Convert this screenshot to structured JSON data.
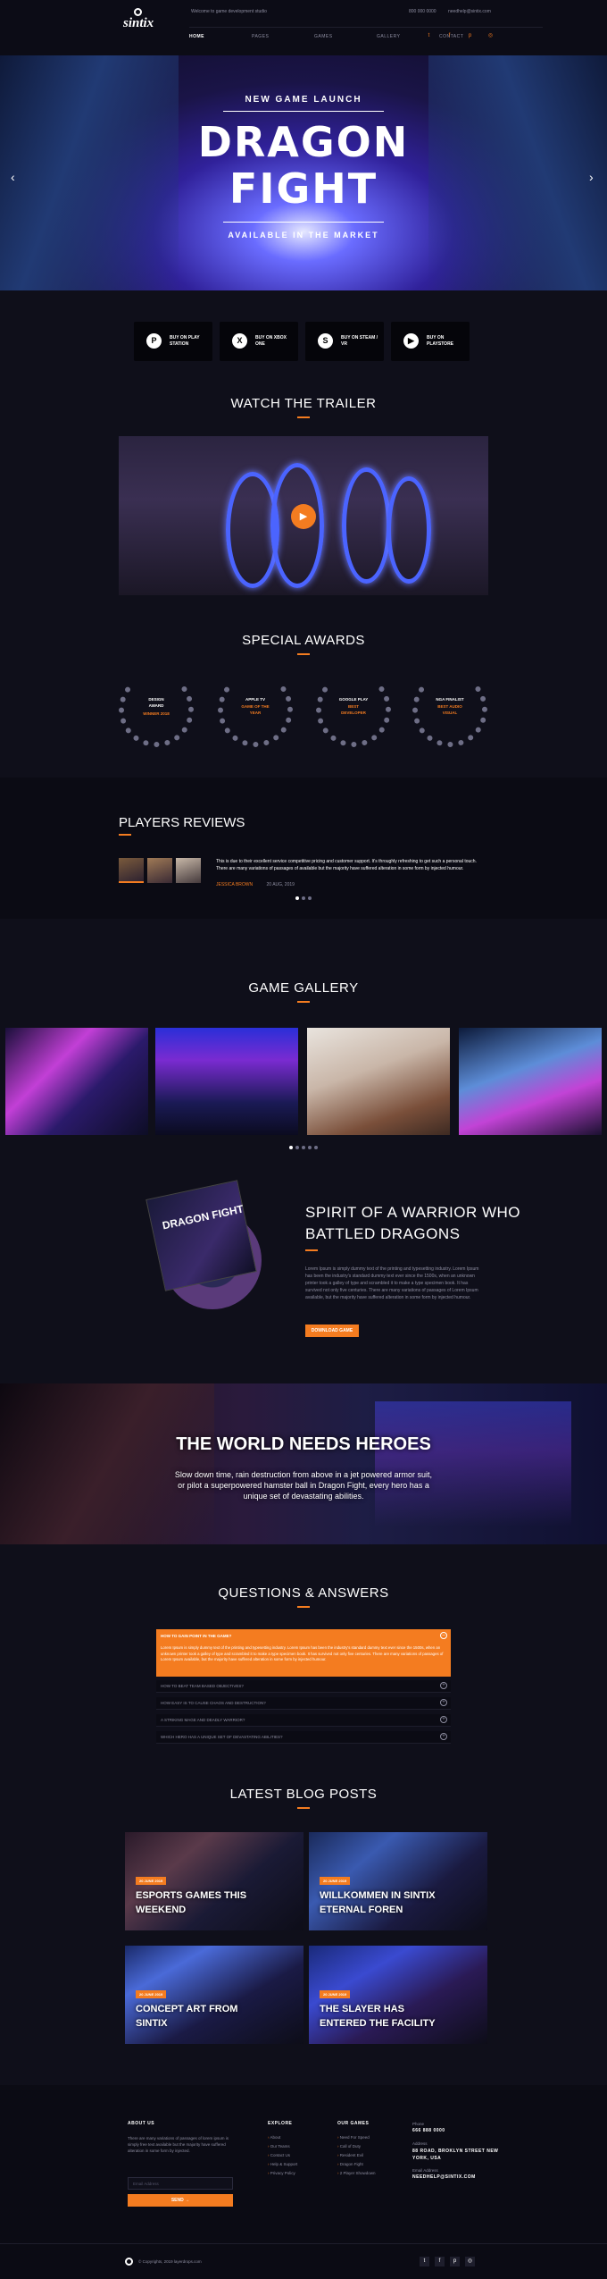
{
  "header": {
    "brand": "sintix",
    "welcome": "Welcome to game development studio",
    "phone": "800 000 0000",
    "email": "needhelp@sintix.com",
    "nav": [
      "HOME",
      "PAGES",
      "GAMES",
      "GALLERY",
      "CONTACT"
    ],
    "social": [
      "twitter",
      "facebook",
      "pinterest",
      "instagram"
    ]
  },
  "hero": {
    "kicker": "NEW GAME LAUNCH",
    "title_line1": "DRAGON",
    "title_line2": "FIGHT",
    "subtitle": "AVAILABLE IN THE MARKET",
    "prev": "‹",
    "next": "›"
  },
  "stores": [
    {
      "label": "BUY ON PLAY STATION",
      "icon": "playstation-icon",
      "glyph": "P"
    },
    {
      "label": "BUY ON XBOX ONE",
      "icon": "xbox-icon",
      "glyph": "X"
    },
    {
      "label": "BUY ON STEAM / VR",
      "icon": "steam-icon",
      "glyph": "S"
    },
    {
      "label": "BUY ON PLAYSTORE",
      "icon": "playstore-icon",
      "glyph": "▶"
    }
  ],
  "trailer": {
    "title": "WATCH THE TRAILER"
  },
  "awards": {
    "title": "SPECIAL AWARDS",
    "items": [
      {
        "line1": "DESIGN",
        "line2": "AWARD",
        "line3": "WINNER 2018"
      },
      {
        "line1": "APPLE TV",
        "line2": "GAME OF THE",
        "line3": "YEAR"
      },
      {
        "line1": "GOOGLE PLAY",
        "line2": "BEST",
        "line3": "DEVELOPER"
      },
      {
        "line1": "NGA FINALIST",
        "line2": "BEST AUDIO",
        "line3": "VISUAL"
      }
    ]
  },
  "reviews": {
    "title": "PLAYERS REVIEWS",
    "text": "This is due to their excellent service competitive pricing and customer support. It's throughly refreshing to get such a personal touch. There are many variations of passages of available but the majority have suffered alteration in some form by injected humour.",
    "author": "JESSICA BROWN",
    "date": "20 AUG, 2019"
  },
  "gallery": {
    "title": "GAME GALLERY"
  },
  "spirit": {
    "title_line1": "SPIRIT OF A WARRIOR WHO",
    "title_line2": "BATTLED DRAGONS",
    "text": "Lorem Ipsum is simply dummy text of the printing and typesetting industry. Lorem Ipsum has been the industry's standard dummy text ever since the 1500s, when an unknown printer took a galley of type and scrambled it to make a type specimen book. It has survived not only five centuries. There are many variations of passages of Lorem Ipsum available, but the majority have suffered alteration in some form by injected humour.",
    "button": "DOWNLOAD GAME",
    "cd_label": "DRAGON FIGHT"
  },
  "heroes": {
    "title": "THE WORLD NEEDS HEROES",
    "text": "Slow down time, rain destruction from above in a jet powered armor suit, or pilot a superpowered hamster ball in Dragon Fight, every hero has a unique set of devastating abilities."
  },
  "faq": {
    "title": "QUESTIONS & ANSWERS",
    "open_question": "HOW TO GAIN POINT IN THE GAME?",
    "open_answer": "Lorem Ipsum is simply dummy text of the printing and typesetting industry. Lorem Ipsum has been the industry's standard dummy text ever since the 1500s, when an unknown printer took a galley of type and scrambled it to make a type specimen book. It has survived not only five centuries. There are many variations of passages of Lorem Ipsum available, but the majority have suffered alteration in some form by injected humour.",
    "questions": [
      "HOW TO BEAT TEAM BASED OBJECTIVES?",
      "HOW EASY IS TO CAUSE CHAOS AND DESTRUCTION?",
      "A STRIKING MAGE AND DEADLY WARRIOR?",
      "WHICH HERO HAS A UNIQUE SET OF DEVASTATING ABILITIES?"
    ]
  },
  "blog": {
    "title": "LATEST BLOG POSTS",
    "posts": [
      {
        "tag": "20 JUNE 2019",
        "line1": "ESPORTS GAMES THIS",
        "line2": "WEEKEND"
      },
      {
        "tag": "20 JUNE 2019",
        "line1": "WILLKOMMEN IN SINTIX",
        "line2": "ETERNAL FOREN"
      },
      {
        "tag": "20 JUNE 2019",
        "line1": "CONCEPT ART FROM",
        "line2": "SINTIX"
      },
      {
        "tag": "20 JUNE 2019",
        "line1": "THE SLAYER HAS",
        "line2": "ENTERED THE FACILITY"
      }
    ]
  },
  "footer": {
    "about_title": "ABOUT US",
    "about_text": "There are many variations of passages of lorem ipsum is simply free text available but the majority have suffered alteration in some form by injected.",
    "email_placeholder": "Email Address",
    "send": "SEND",
    "explore_title": "EXPLORE",
    "explore": [
      "About",
      "Our Teams",
      "Contact Us",
      "Help & Support",
      "Privacy Policy"
    ],
    "games_title": "OUR GAMES",
    "games": [
      "Need For Speed",
      "Call of Duty",
      "Resident Evil",
      "Dragon Fight",
      "2 Player Showdown"
    ],
    "phone_title": "Phone",
    "phone": "666 888 0000",
    "address_title": "Address",
    "address_line1": "88 ROAD, BROKLYN STREET NEW",
    "address_line2": "YORK, USA",
    "email_title": "Email Address",
    "email": "NEEDHELP@SINTIX.COM",
    "copyright": "© Copyrights, 2019 layerdrops.com"
  }
}
